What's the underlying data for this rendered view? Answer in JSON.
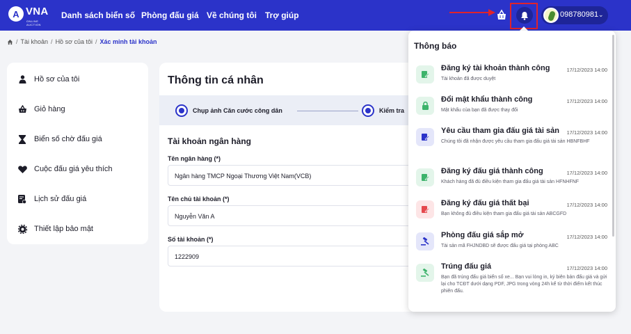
{
  "header": {
    "logo_text": "VNA",
    "logo_sub": "ONLINE AUCTION",
    "nav": [
      "Danh sách biển số",
      "Phòng đấu giá",
      "Về chúng tôi",
      "Trợ giúp"
    ],
    "phone": "098780981",
    "accent": "#2b33c9",
    "highlight": "#e0232b"
  },
  "breadcrumb": [
    "Tài khoản",
    "Hồ sơ của tôi",
    "Xác minh tài khoản"
  ],
  "sidebar": {
    "items": [
      {
        "label": "Hồ sơ của tôi",
        "icon": "user-icon"
      },
      {
        "label": "Giỏ hàng",
        "icon": "cart-icon"
      },
      {
        "label": "Biển số chờ đấu giá",
        "icon": "hourglass-icon"
      },
      {
        "label": "Cuộc đấu giá yêu thích",
        "icon": "heart-icon"
      },
      {
        "label": "Lịch sử đấu giá",
        "icon": "history-icon"
      },
      {
        "label": "Thiết lập bảo mật",
        "icon": "settings-icon"
      }
    ]
  },
  "main": {
    "title": "Thông tin cá nhân",
    "steps": [
      "Chụp ảnh Căn cước công dân",
      "Kiểm tra"
    ],
    "section_title": "Tài khoản ngân hàng",
    "fields": [
      {
        "label": "Tên ngân hàng (*)",
        "value": "Ngân hàng TMCP Ngoại Thương Việt Nam(VCB)"
      },
      {
        "label": "Tên chủ tài khoản (*)",
        "value": "Nguyễn Văn A"
      },
      {
        "label": "Số tài khoản (*)",
        "value": "1222909"
      }
    ]
  },
  "notifications": {
    "title": "Thông báo",
    "items": [
      {
        "title": "Đăng ký tài khoản thành công",
        "time": "17/12/2023 14:00",
        "desc": "Tài khoản đã được duyệt",
        "icon": "edit-icon",
        "color": "#3db36b",
        "bg": "#e3f5ea"
      },
      {
        "title": "Đổi mật khẩu thành công",
        "time": "17/12/2023 14:00",
        "desc": "Mật khẩu của bạn đã được thay đổi",
        "icon": "lock-icon",
        "color": "#3db36b",
        "bg": "#e3f5ea"
      },
      {
        "title": "Yêu cầu tham gia đấu giá tài sản",
        "time": "17/12/2023 14:00",
        "desc": "Chúng tôi đã nhận được yêu cầu tham gia đấu giá tài sản HBNFBHF",
        "icon": "edit-icon",
        "color": "#2b33c9",
        "bg": "#e4e6fa"
      },
      {
        "title": "Đăng ký đấu giá thành công",
        "time": "17/12/2023 14:00",
        "desc": "Khách hàng đã đủ điều kiện tham gia đấu giá tài sản HFNHFNF",
        "icon": "edit-icon",
        "color": "#3db36b",
        "bg": "#e3f5ea"
      },
      {
        "title": "Đăng ký đấu giá thất bại",
        "time": "17/12/2023 14:00",
        "desc": "Bạn không đủ điều kiện tham gia đấu giá tài sản ABCGFD",
        "icon": "edit-icon",
        "color": "#e5484d",
        "bg": "#fde5e6"
      },
      {
        "title": "Phòng đấu giá sắp mở",
        "time": "17/12/2023 14:00",
        "desc": "Tài sản mã FHJNDBD sẽ được đấu giá tại phòng ABC",
        "icon": "gavel-icon",
        "color": "#2b33c9",
        "bg": "#e4e6fa"
      },
      {
        "title": "Trúng đấu giá",
        "time": "17/12/2023 14:00",
        "desc": "Bạn đã trúng đấu giá biển số xe... Bạn vui lòng in, ký biên bản đấu giá và gửi lại cho TCĐT dưới dạng PDF, JPG trong vòng 24h kể từ thời điểm kết thúc phiên đấu.",
        "icon": "gavel-icon",
        "color": "#3db36b",
        "bg": "#e3f5ea"
      }
    ]
  }
}
